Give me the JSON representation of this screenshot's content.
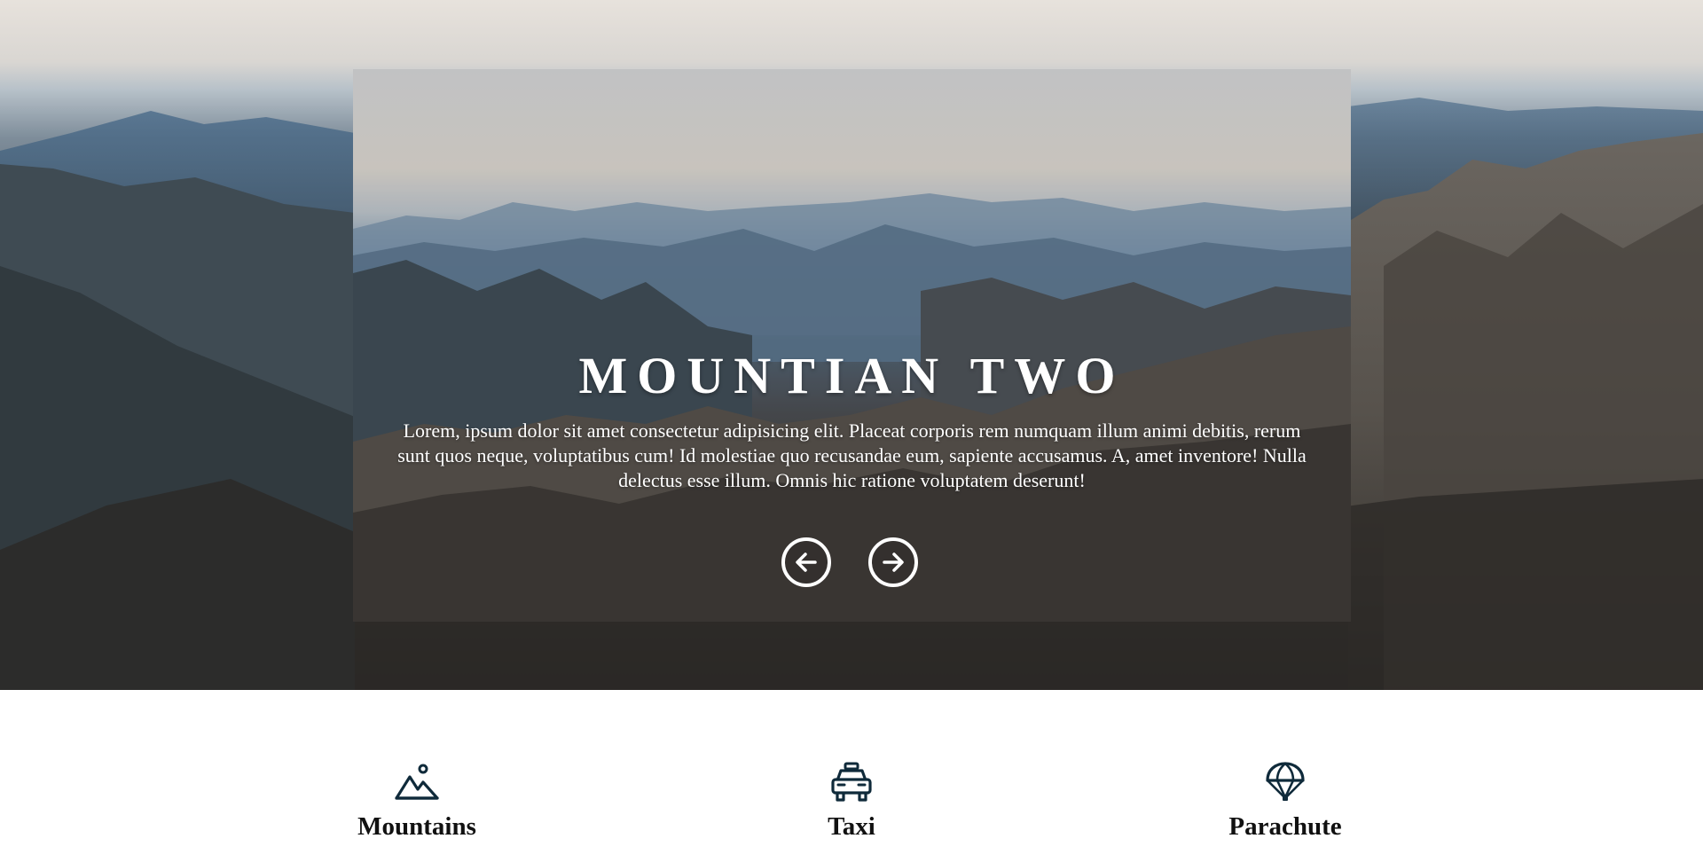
{
  "hero": {
    "slide": {
      "title": "MOUNTIAN TWO",
      "text": "Lorem, ipsum dolor sit amet consectetur adipisicing elit. Placeat corporis rem numquam illum animi debitis, rerum sunt quos neque, voluptatibus cum! Id molestiae quo recusandae eum, sapiente accusamus. A, amet inventore! Nulla delectus esse illum. Omnis hic ratione voluptatem deserunt!",
      "prev_icon": "arrow-left-circle-icon",
      "next_icon": "arrow-right-circle-icon"
    }
  },
  "features": [
    {
      "label": "Mountains",
      "icon": "mountain-icon"
    },
    {
      "label": "Taxi",
      "icon": "taxi-icon"
    },
    {
      "label": "Parachute",
      "icon": "parachute-icon"
    }
  ],
  "colors": {
    "icon": "#0f2a3a",
    "text": "#ffffff"
  }
}
